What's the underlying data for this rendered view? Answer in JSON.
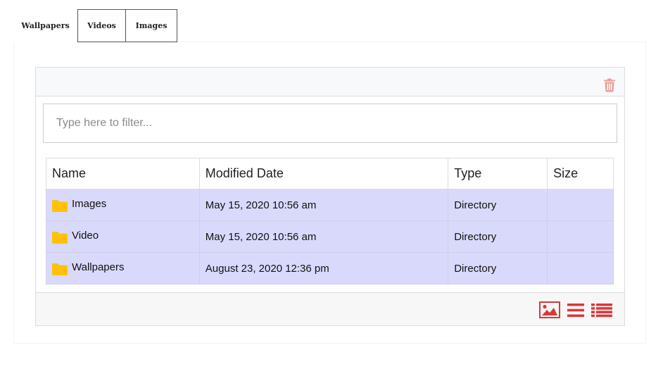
{
  "tabs": [
    {
      "label": "Wallpapers",
      "active": true
    },
    {
      "label": "Videos",
      "active": false
    },
    {
      "label": "Images",
      "active": false
    }
  ],
  "filter": {
    "placeholder": "Type here to filter...",
    "value": ""
  },
  "table": {
    "columns": {
      "name": "Name",
      "modified": "Modified Date",
      "type": "Type",
      "size": "Size"
    },
    "rows": [
      {
        "name": "Images",
        "modified": "May 15, 2020 10:56 am",
        "type": "Directory",
        "size": ""
      },
      {
        "name": "Video",
        "modified": "May 15, 2020 10:56 am",
        "type": "Directory",
        "size": ""
      },
      {
        "name": "Wallpapers",
        "modified": "August 23, 2020 12:36 pm",
        "type": "Directory",
        "size": ""
      }
    ]
  },
  "icons": {
    "trash": "trash-icon",
    "folder": "folder-icon",
    "views": [
      "image-view-icon",
      "list-view-icon",
      "detail-list-view-icon"
    ]
  },
  "colors": {
    "accent": "#d9383a",
    "trash": "#e6a09a",
    "folder": "#ffc107",
    "row_highlight": "#d9d9fc"
  }
}
